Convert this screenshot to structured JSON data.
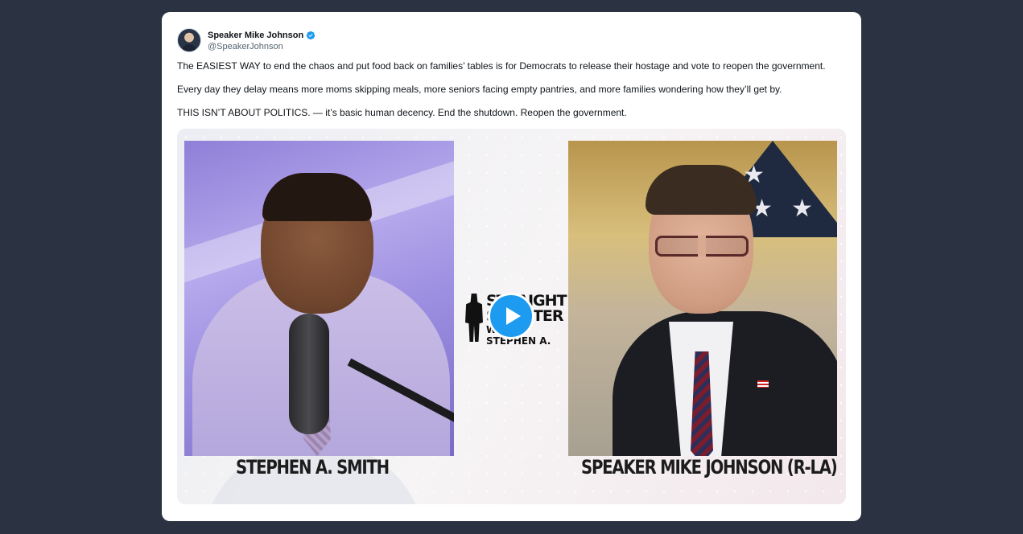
{
  "author": {
    "display_name": "Speaker Mike Johnson",
    "handle": "@SpeakerJohnson",
    "verified": true
  },
  "tweet": {
    "paragraphs": [
      "The EASIEST WAY to end the chaos and put food back on families’ tables is for Democrats to release their hostage and vote to reopen the government.",
      "Every day they delay means more moms skipping meals, more seniors facing empty pantries, and more families wondering how they’ll get by.",
      "THIS ISN’T ABOUT POLITICS. — it’s basic human decency. End the shutdown. Reopen the government."
    ]
  },
  "video": {
    "left_caption": "STEPHEN A. SMITH",
    "right_caption": "SPEAKER MIKE JOHNSON (R-LA)",
    "logo_line1": "STRAIGHT",
    "logo_line2": "SHOOTER",
    "logo_line3": "WITH STEPHEN A.",
    "play_icon": "play-icon"
  },
  "colors": {
    "background": "#2b3241",
    "card": "#ffffff",
    "verified": "#1d9bf0",
    "play_button": "#1d9bf0",
    "handle": "#536471"
  }
}
